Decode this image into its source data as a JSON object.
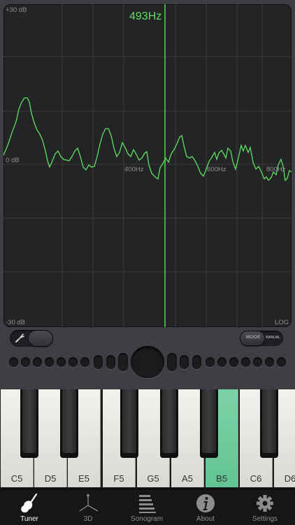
{
  "spectrum": {
    "frequency_readout": "493Hz",
    "db_top": "+30 dB",
    "db_mid": "0 dB",
    "db_bottom": "-30 dB",
    "freq_400": "400Hz",
    "freq_600": "600Hz",
    "freq_800": "800Hz",
    "scale_mode": "LOG",
    "line_color": "#5fe060"
  },
  "controls": {
    "tuning_fork_icon": "tuning-fork-icon",
    "mode_label": "MODE",
    "manual_label": "MANUAL"
  },
  "keyboard": {
    "keys": [
      "C5",
      "D5",
      "E5",
      "F5",
      "G5",
      "A5",
      "B5",
      "C6",
      "D6"
    ],
    "active_key": "B5",
    "active_color": "#6ec99c"
  },
  "tabs": [
    {
      "label": "Tuner",
      "icon": "guitar-icon",
      "selected": true
    },
    {
      "label": "3D",
      "icon": "axes-3d-icon",
      "selected": false
    },
    {
      "label": "Sonogram",
      "icon": "sonogram-icon",
      "selected": false
    },
    {
      "label": "About",
      "icon": "info-icon",
      "selected": false
    },
    {
      "label": "Settings",
      "icon": "gear-icon",
      "selected": false
    }
  ]
}
